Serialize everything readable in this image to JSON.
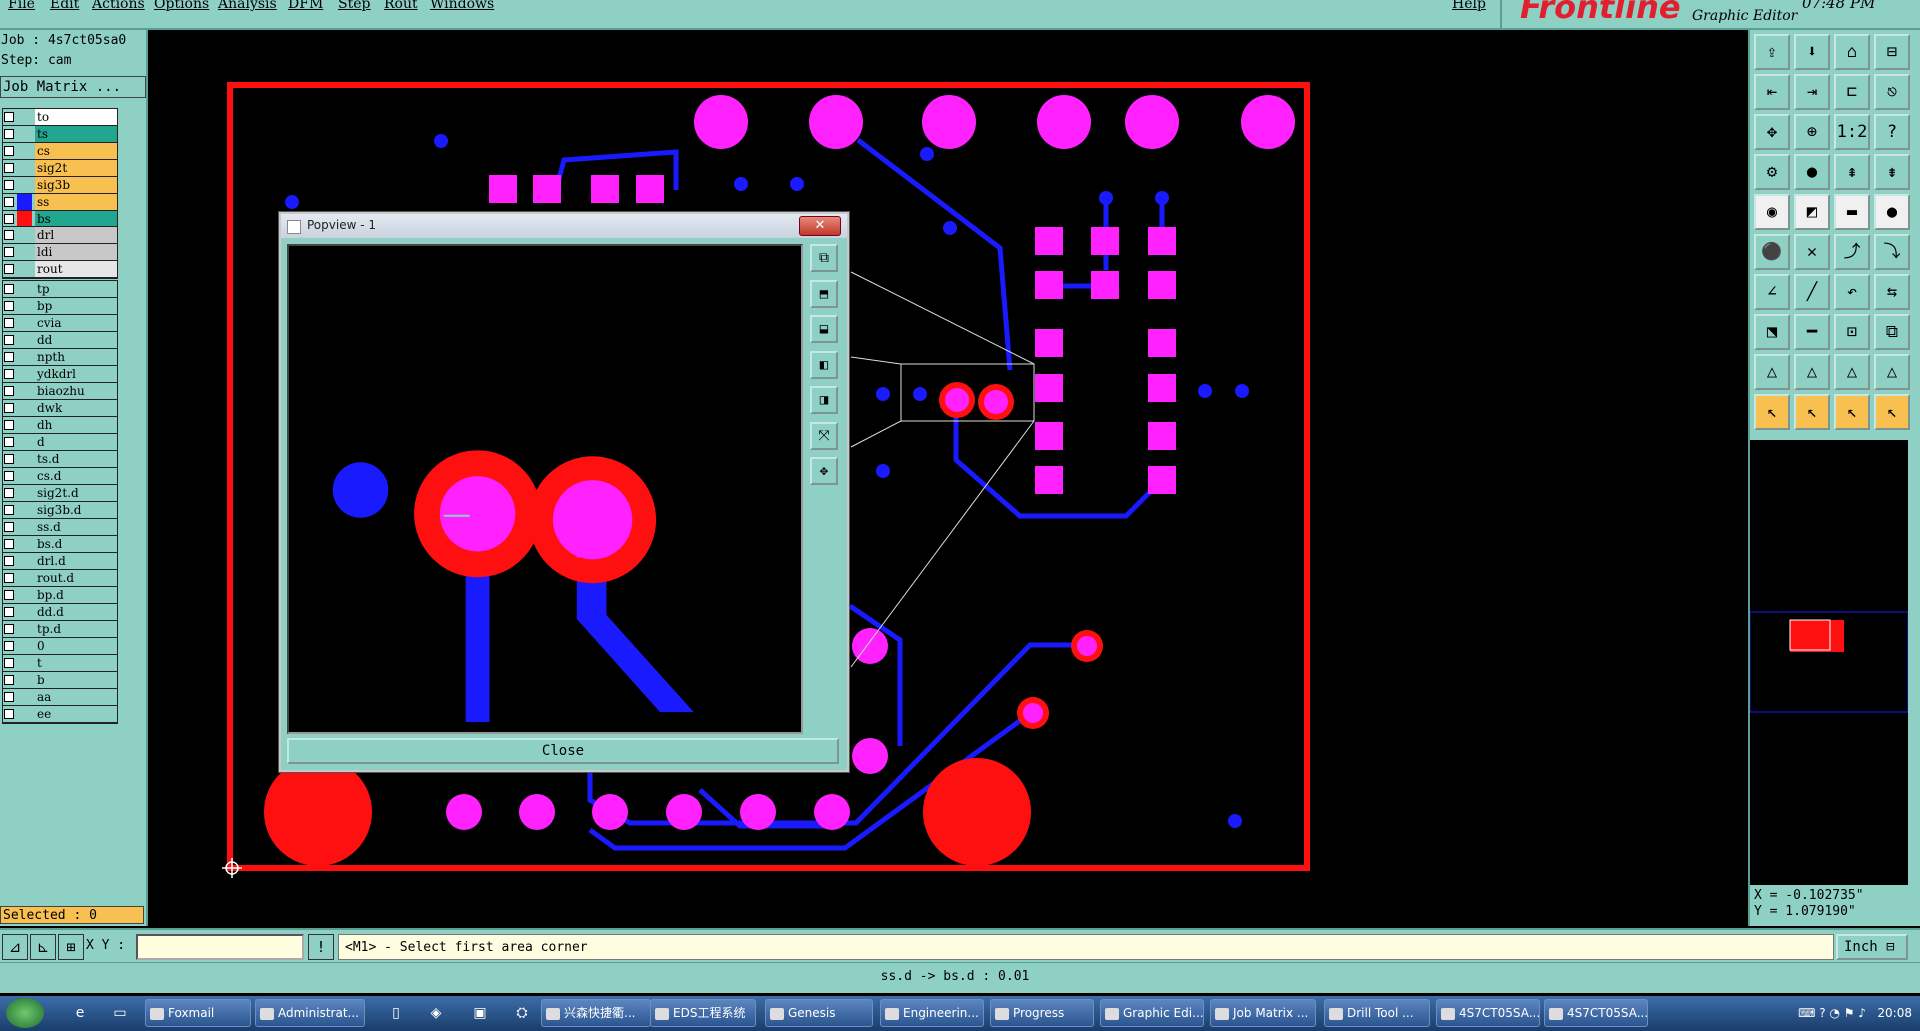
{
  "menu": [
    "File",
    "Edit",
    "Actions",
    "Options",
    "Analysis",
    "DFM",
    "Step",
    "Rout",
    "Windows"
  ],
  "help": "Help",
  "brand": {
    "logo": "Frontline",
    "app": "Graphic Editor",
    "clock": "07:48 PM"
  },
  "job": {
    "job_line": "Job : 4s7ct05sa0",
    "step_line": "Step: cam",
    "matrix_button": "Job Matrix ..."
  },
  "colors": {
    "pad": "#ff22ff",
    "outline": "#ff1010",
    "trace": "#1a1aff",
    "panel": "#8fd0c4",
    "highlight": "#f7c050",
    "teal_row": "#23a690"
  },
  "layers_group1": [
    {
      "name": "to",
      "bg": "#ffffff",
      "swatch": ""
    },
    {
      "name": "ts",
      "bg": "#23a690",
      "swatch": ""
    },
    {
      "name": "cs",
      "bg": "#f7c050",
      "swatch": ""
    },
    {
      "name": "sig2t",
      "bg": "#f7c050",
      "swatch": ""
    },
    {
      "name": "sig3b",
      "bg": "#f7c050",
      "swatch": ""
    },
    {
      "name": "ss",
      "bg": "#f7c050",
      "swatch": "#1a1aff"
    },
    {
      "name": "bs",
      "bg": "#23a690",
      "swatch": "#ff1010"
    }
  ],
  "layers_group2": [
    {
      "name": "drl",
      "bg": "#c8c8c8",
      "swatch": ""
    },
    {
      "name": "ldi",
      "bg": "#c8c8c8",
      "swatch": ""
    },
    {
      "name": "rout",
      "bg": "#e6e6e6",
      "swatch": ""
    }
  ],
  "layers_group3": [
    {
      "name": "tp",
      "bg": "#8fd0c4",
      "swatch": ""
    },
    {
      "name": "bp",
      "bg": "#8fd0c4",
      "swatch": ""
    },
    {
      "name": "cvia",
      "bg": "#8fd0c4",
      "swatch": ""
    },
    {
      "name": "dd",
      "bg": "#8fd0c4",
      "swatch": ""
    },
    {
      "name": "npth",
      "bg": "#8fd0c4",
      "swatch": ""
    },
    {
      "name": "ydkdrl",
      "bg": "#8fd0c4",
      "swatch": ""
    },
    {
      "name": "biaozhu",
      "bg": "#8fd0c4",
      "swatch": ""
    },
    {
      "name": "dwk",
      "bg": "#8fd0c4",
      "swatch": ""
    },
    {
      "name": "dh",
      "bg": "#8fd0c4",
      "swatch": ""
    },
    {
      "name": "d",
      "bg": "#8fd0c4",
      "swatch": ""
    },
    {
      "name": "ts.d",
      "bg": "#8fd0c4",
      "swatch": ""
    },
    {
      "name": "cs.d",
      "bg": "#8fd0c4",
      "swatch": ""
    },
    {
      "name": "sig2t.d",
      "bg": "#8fd0c4",
      "swatch": ""
    },
    {
      "name": "sig3b.d",
      "bg": "#8fd0c4",
      "swatch": ""
    },
    {
      "name": "ss.d",
      "bg": "#8fd0c4",
      "swatch": ""
    },
    {
      "name": "bs.d",
      "bg": "#8fd0c4",
      "swatch": ""
    },
    {
      "name": "drl.d",
      "bg": "#8fd0c4",
      "swatch": ""
    },
    {
      "name": "rout.d",
      "bg": "#8fd0c4",
      "swatch": ""
    },
    {
      "name": "bp.d",
      "bg": "#8fd0c4",
      "swatch": ""
    },
    {
      "name": "dd.d",
      "bg": "#8fd0c4",
      "swatch": ""
    },
    {
      "name": "tp.d",
      "bg": "#8fd0c4",
      "swatch": ""
    },
    {
      "name": "0",
      "bg": "#8fd0c4",
      "swatch": ""
    },
    {
      "name": "t",
      "bg": "#8fd0c4",
      "swatch": ""
    },
    {
      "name": "b",
      "bg": "#8fd0c4",
      "swatch": ""
    },
    {
      "name": "aa",
      "bg": "#8fd0c4",
      "swatch": ""
    },
    {
      "name": "ee",
      "bg": "#8fd0c4",
      "swatch": ""
    }
  ],
  "selected": "Selected : 0",
  "popview": {
    "title": "Popview - 1",
    "close_x": "✕",
    "close_button": "Close"
  },
  "coords": {
    "x": "X = -0.102735\"",
    "y": "Y = 1.079190\""
  },
  "cmd": {
    "xy_label": "X Y :",
    "input_value": "",
    "prompt": "<M1> - Select first area corner",
    "units": "Inch ⊟"
  },
  "status": "ss.d -> bs.d : 0.01",
  "taskbar": {
    "tasks": [
      "Foxmail",
      "Administrat...",
      "兴森快捷衢...",
      "EDS工程系统",
      "Genesis",
      "Engineerin...",
      "Progress",
      "Graphic Edi...",
      "Job Matrix ...",
      "Drill Tool ...",
      "4S7CT05SA...",
      "4S7CT05SA..."
    ],
    "time": "20:08"
  },
  "toolbar_icons": [
    "open-icon",
    "save-icon",
    "home-icon",
    "layout-icon",
    "import-icon",
    "export-icon",
    "mirror-icon",
    "snap-icon",
    "fit-icon",
    "pan-icon",
    "one-to-two-icon",
    "help-icon",
    "measure-icon",
    "probe-icon",
    "layer-up-icon",
    "layer-down-icon",
    "pad-icon",
    "draw-icon",
    "line-icon",
    "circle-icon",
    "node-icon",
    "cross-icon",
    "route-icon",
    "arc-icon",
    "angle-icon",
    "slash-icon",
    "undo-icon",
    "flip-icon",
    "step-icon",
    "line-h-icon",
    "fill-icon",
    "group-icon",
    "triangle-icon",
    "triangle2-icon",
    "triangle3-icon",
    "triangle4-icon",
    "pointer-icon",
    "pointer2-icon",
    "pointer3-icon",
    "pointer4-icon"
  ]
}
